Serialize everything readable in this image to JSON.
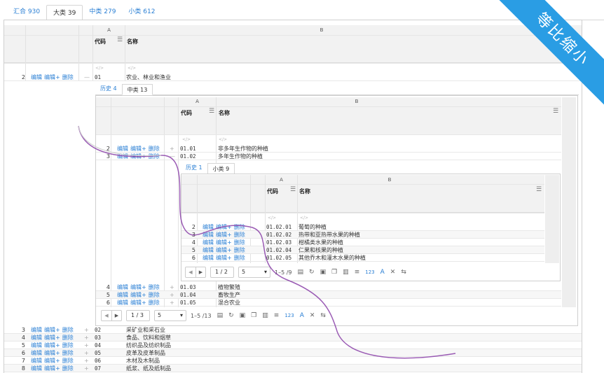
{
  "top_tabs": [
    {
      "label": "汇合 930"
    },
    {
      "label": "大类 39"
    },
    {
      "label": "中类 279"
    },
    {
      "label": "小类 612"
    }
  ],
  "ribbon": "等比缩小",
  "lvl1": {
    "col_a": "A",
    "col_b": "B",
    "h_code": "代码",
    "h_name": "名称",
    "row2": {
      "n": "2",
      "edit": "编辑",
      "editplus": "编辑+",
      "del": "删除",
      "exp": "—",
      "code": "01",
      "name": "农业、林业和渔业"
    },
    "rows": [
      {
        "n": "3",
        "edit": "编辑",
        "editplus": "编辑+",
        "del": "删除",
        "exp": "+",
        "code": "02",
        "name": "采矿业和采石业"
      },
      {
        "n": "4",
        "edit": "编辑",
        "editplus": "编辑+",
        "del": "删除",
        "exp": "+",
        "code": "03",
        "name": "食品、饮料和烟草"
      },
      {
        "n": "5",
        "edit": "编辑",
        "editplus": "编辑+",
        "del": "删除",
        "exp": "+",
        "code": "04",
        "name": "纺织品及纺织制品"
      },
      {
        "n": "6",
        "edit": "编辑",
        "editplus": "编辑+",
        "del": "删除",
        "exp": "+",
        "code": "05",
        "name": "皮革及皮革制品"
      },
      {
        "n": "7",
        "edit": "编辑",
        "editplus": "编辑+",
        "del": "删除",
        "exp": "+",
        "code": "06",
        "name": "木材及木制品"
      },
      {
        "n": "8",
        "edit": "编辑",
        "editplus": "编辑+",
        "del": "删除",
        "exp": "+",
        "code": "07",
        "name": "纸浆、纸及纸制品"
      }
    ]
  },
  "lvl2": {
    "tabs": [
      {
        "label": "历史 4"
      },
      {
        "label": "中类 13"
      }
    ],
    "col_a": "A",
    "col_b": "B",
    "h_code": "代码",
    "h_name": "名称",
    "rows_top": [
      {
        "n": "2",
        "edit": "编辑",
        "editplus": "编辑+",
        "del": "删除",
        "exp": "+",
        "code": "01.01",
        "name": "非多年生作物的种植"
      },
      {
        "n": "3",
        "edit": "编辑",
        "editplus": "编辑+",
        "del": "删除",
        "exp": "—",
        "code": "01.02",
        "name": "多年生作物的种植"
      }
    ],
    "rows_bottom": [
      {
        "n": "4",
        "edit": "编辑",
        "editplus": "编辑+",
        "del": "删除",
        "exp": "+",
        "code": "01.03",
        "name": "植物繁殖"
      },
      {
        "n": "5",
        "edit": "编辑",
        "editplus": "编辑+",
        "del": "删除",
        "exp": "+",
        "code": "01.04",
        "name": "畜牧生产"
      },
      {
        "n": "6",
        "edit": "编辑",
        "editplus": "编辑+",
        "del": "删除",
        "exp": "+",
        "code": "01.05",
        "name": "混合农业"
      }
    ],
    "pager": {
      "page": "1",
      "sep": "/",
      "total": "3",
      "size": "5",
      "info": "1–5 /13"
    }
  },
  "lvl3": {
    "tabs": [
      {
        "label": "历史 1"
      },
      {
        "label": "小类 9"
      }
    ],
    "col_a": "A",
    "col_b": "B",
    "h_code": "代码",
    "h_name": "名称",
    "rows": [
      {
        "n": "2",
        "edit": "编辑",
        "editplus": "编辑+",
        "del": "删除",
        "code": "01.02.01",
        "name": "葡萄的种植"
      },
      {
        "n": "3",
        "edit": "编辑",
        "editplus": "编辑+",
        "del": "删除",
        "code": "01.02.02",
        "name": "热带和亚热带水果的种植"
      },
      {
        "n": "4",
        "edit": "编辑",
        "editplus": "编辑+",
        "del": "删除",
        "code": "01.02.03",
        "name": "柑橘类水果的种植"
      },
      {
        "n": "5",
        "edit": "编辑",
        "editplus": "编辑+",
        "del": "删除",
        "code": "01.02.04",
        "name": "仁果和核果的种植"
      },
      {
        "n": "6",
        "edit": "编辑",
        "editplus": "编辑+",
        "del": "删除",
        "code": "01.02.05",
        "name": "其他乔木和灌木水果的种植"
      }
    ],
    "pager": {
      "page": "1",
      "sep": "/",
      "total": "2",
      "size": "5",
      "info": "1–5 /9"
    }
  },
  "toolbar_icons": [
    "table-icon",
    "refresh-icon",
    "excel-icon",
    "copy-icon",
    "column-icon",
    "sort-icon",
    "numeric-123-icon",
    "font-a-icon",
    "tools-icon",
    "wrap-icon"
  ],
  "tool_labels": {
    "num": "123",
    "a": "A"
  }
}
